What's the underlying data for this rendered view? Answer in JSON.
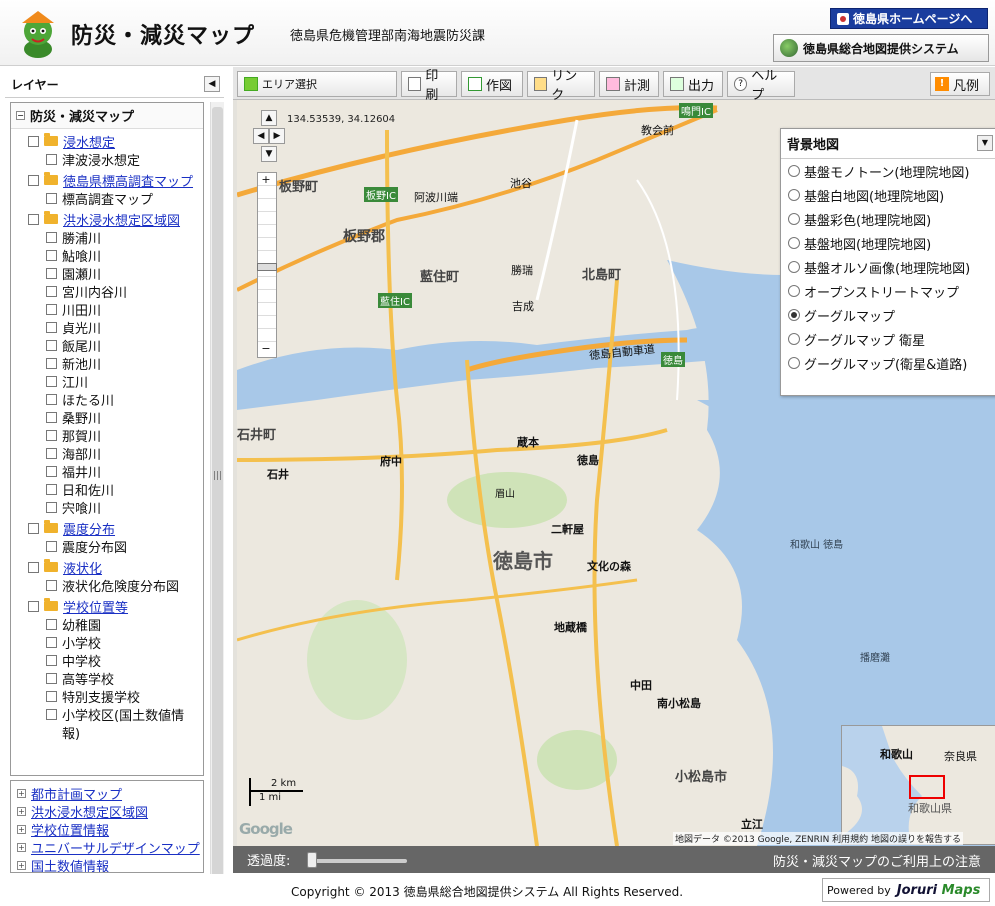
{
  "header": {
    "title": "防災・減災マップ",
    "department": "徳島県危機管理部南海地震防災課",
    "pref_link": "徳島県ホームページへ",
    "gis_link": "徳島県総合地図提供システム"
  },
  "left_panel": {
    "title": "レイヤー",
    "collapse_icon": "◀",
    "tree_root": "防災・減災マップ",
    "groups": [
      {
        "label": "浸水想定",
        "children": [
          "津波浸水想定"
        ]
      },
      {
        "label": "徳島県標高調査マップ",
        "children": [
          "標高調査マップ"
        ]
      },
      {
        "label": "洪水浸水想定区域図",
        "children": [
          "勝浦川",
          "鮎喰川",
          "園瀬川",
          "宮川内谷川",
          "川田川",
          "貞光川",
          "飯尾川",
          "新池川",
          "江川",
          "ほたる川",
          "桑野川",
          "那賀川",
          "海部川",
          "福井川",
          "日和佐川",
          "宍喰川"
        ]
      },
      {
        "label": "震度分布",
        "children": [
          "震度分布図"
        ]
      },
      {
        "label": "液状化",
        "children": [
          "液状化危険度分布図"
        ]
      },
      {
        "label": "学校位置等",
        "children": [
          "幼稚園",
          "小学校",
          "中学校",
          "高等学校",
          "特別支援学校",
          "小学校区(国土数値情",
          "報)"
        ]
      }
    ],
    "bottom_links": [
      "都市計画マップ",
      "洪水浸水想定区域図",
      "学校位置情報",
      "ユニバーサルデザインマップ",
      "国土数値情報"
    ]
  },
  "toolbar": {
    "area_select": "エリア選択",
    "print": "印刷",
    "draw": "作図",
    "link": "リンク",
    "measure": "計測",
    "output": "出力",
    "help": "ヘルプ",
    "legend": "凡例"
  },
  "map": {
    "coord": "134.53539, 34.12604",
    "scale_km": "2 km",
    "scale_mi": "1 mi",
    "attribution": "地図データ ©2013 Google, ZENRIN  利用規約  地図の誤りを報告する",
    "google": "Google",
    "labels": {
      "naruto_ic": "鳴門IC",
      "kyokai": "教会前",
      "itano_cho": "板野町",
      "itano_ic": "板野IC",
      "awa_kawabata": "阿波川端",
      "ikeya": "池谷",
      "itano_gun": "板野郡",
      "aizumi": "藍住町",
      "kitajima": "北島町",
      "shoraku": "勝瑞",
      "yoshinari": "吉成",
      "aizumi_ic": "藍住IC",
      "tokushima_ic": "徳島",
      "expressway": "徳島自動車道",
      "ishii": "石井町",
      "ishii2": "石井",
      "fuchu": "府中",
      "kuramoto": "蔵本",
      "tokushima_st": "徳島",
      "tokushima_city": "徳島市",
      "bizan": "眉山",
      "nikenya": "二軒屋",
      "bunka": "文化の森",
      "jizo": "地蔵橋",
      "nakata": "中田",
      "minami_komatsu": "南小松島",
      "komatsushima": "小松島市",
      "tachie": "立江",
      "wakayama_tokushima": "和歌山 徳島",
      "harima": "播磨灘"
    },
    "overview": {
      "wakayama": "和歌山",
      "nara": "奈良県",
      "wakayama_pref": "和歌山県"
    }
  },
  "base_map": {
    "title": "背景地図",
    "options": [
      {
        "label": "基盤モノトーン(地理院地図)",
        "selected": false
      },
      {
        "label": "基盤白地図(地理院地図)",
        "selected": false
      },
      {
        "label": "基盤彩色(地理院地図)",
        "selected": false
      },
      {
        "label": "基盤地図(地理院地図)",
        "selected": false
      },
      {
        "label": "基盤オルソ画像(地理院地図)",
        "selected": false
      },
      {
        "label": "オープンストリートマップ",
        "selected": false
      },
      {
        "label": "グーグルマップ",
        "selected": true
      },
      {
        "label": "グーグルマップ 衛星",
        "selected": false
      },
      {
        "label": "グーグルマップ(衛星&道路)",
        "selected": false
      }
    ]
  },
  "transparency": {
    "label": "透過度:",
    "notice": "防災・減災マップのご利用上の注意"
  },
  "footer": {
    "copyright": "Copyright © 2013 徳島県総合地図提供システム All Rights Reserved.",
    "powered_by": "Powered by",
    "powered_brand_1": "Joruri ",
    "powered_brand_2": "Maps"
  }
}
